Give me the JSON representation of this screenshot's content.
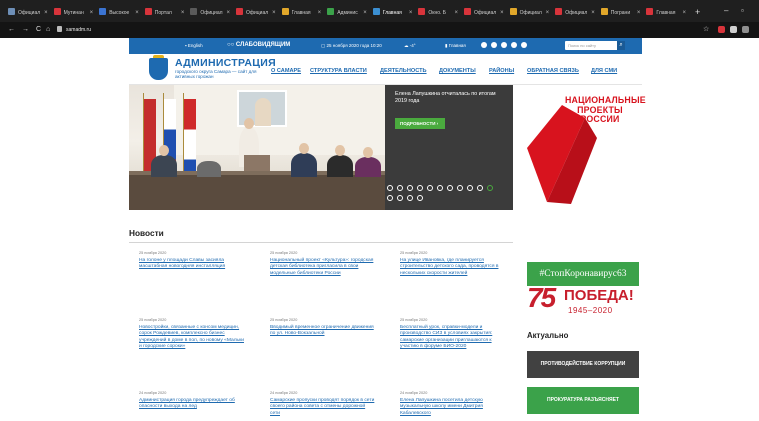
{
  "browser": {
    "tabs": [
      {
        "label": "Официал",
        "color": "#6e8fb7",
        "active": false
      },
      {
        "label": "Мутинан",
        "color": "#d8343b",
        "active": false
      },
      {
        "label": "Высокое",
        "color": "#3b74d2",
        "active": false
      },
      {
        "label": "Портал",
        "color": "#d8343b",
        "active": false
      },
      {
        "label": "Официал",
        "color": "#5a5a5a",
        "active": false
      },
      {
        "label": "Официал",
        "color": "#d8343b",
        "active": false
      },
      {
        "label": "Главная",
        "color": "#e1a72a",
        "active": false
      },
      {
        "label": "Админис",
        "color": "#3ba24a",
        "active": false
      },
      {
        "label": "Главная",
        "color": "#3b8fd2",
        "active": true
      },
      {
        "label": "Окно. Б",
        "color": "#d8343b",
        "active": false
      },
      {
        "label": "Официал",
        "color": "#d8343b",
        "active": false
      },
      {
        "label": "Официал",
        "color": "#e1a72a",
        "active": false
      },
      {
        "label": "Официал",
        "color": "#d8343b",
        "active": false
      },
      {
        "label": "Пограни",
        "color": "#e1a72a",
        "active": false
      },
      {
        "label": "Главная",
        "color": "#d8343b",
        "active": false
      }
    ],
    "new_tab": "+",
    "minimize": "–",
    "maximize": "▫",
    "url": "samadm.ru",
    "back": "←",
    "forward": "→",
    "reload": "C",
    "home": "⌂",
    "star": "☆"
  },
  "topbar": {
    "english": "English",
    "accessible": "СЛАБОВИДЯЩИМ",
    "date": "25 ноября 2020 года 10:20",
    "weather": "-4°",
    "city": "Главная",
    "search_placeholder": "Поиск по сайту"
  },
  "header": {
    "title": "АДМИНИСТРАЦИЯ",
    "subtitle": "городского округа Самара — сайт для активных горожан",
    "menu": [
      "О САМАРЕ",
      "СТРУКТУРА ВЛАСТИ",
      "ДЕЯТЕЛЬНОСТЬ",
      "ДОКУМЕНТЫ",
      "РАЙОНЫ",
      "ОБРАТНАЯ СВЯЗЬ",
      "ДЛЯ СМИ"
    ]
  },
  "slider": {
    "caption": "Елена Лапушкина отчиталась по итогам 2019 года",
    "more_label": "ПОДРОБНОСТИ  ›",
    "dots_total": 15,
    "active_dot": 10
  },
  "national_projects": {
    "text": "НАЦИОНАЛЬНЫЕ ПРОЕКТЫ РОССИИ",
    "color": "#d8131e"
  },
  "news": {
    "heading": "Новости",
    "items": [
      {
        "date": "25 ноября 2020",
        "title": "На голоне у площади Славы засияла масштабная новогодняя инсталляция"
      },
      {
        "date": "25 ноября 2020",
        "title": "Национальный проект «Культура»: городская детская библиотека пригласила в свои модельные библиотеки России"
      },
      {
        "date": "25 ноября 2020",
        "title": "На улице Ивановка, где планируется строительство детского сада, проводятся в нескольких скорости жителей"
      },
      {
        "date": "25 ноября 2020",
        "title": "Новостройки, связанные с консом медицин, сорок Рождевиев, комплексно бизнес учреждений в доме в пол, по новому «Мальки и городские сороки»"
      },
      {
        "date": "25 ноября 2020",
        "title": "Вводимый временное ограничение движения по ул. Ново-Вокзальной"
      },
      {
        "date": "25 ноября 2020",
        "title": "Бесплатный урок, справки-модели и производство СИЗ в условиях закрытия: самарские организации приглашаются к участию в форуме БИО-2020"
      },
      {
        "date": "24 ноября 2020",
        "title": "Администрация города предупреждает об опасности выхода на лед"
      },
      {
        "date": "24 ноября 2020",
        "title": "Самарские пропуски проводят порядок в сети своего района совета с отмены дорожной сети"
      },
      {
        "date": "24 ноября 2020",
        "title": "Елена Лапушкина посетила детскую музыкальную школу имени Дмитрия Кабалевского"
      }
    ]
  },
  "sidebar": {
    "stop_corona": "#СтопКоронавирус63",
    "pobeda_number": "75",
    "pobeda_word": "ПОБЕДА!",
    "pobeda_years": "1945–2020",
    "actual_heading": "Актуально",
    "anticorruption": "ПРОТИВОДЕЙСТВИЕ КОРРУПЦИИ",
    "prosecutor": "ПРОКУРАТУРА РАЗЪЯСНЯЕТ"
  },
  "colors": {
    "brand_blue": "#1e6ab0",
    "green": "#3ba24a",
    "red": "#d8131e",
    "dark": "#414141"
  }
}
